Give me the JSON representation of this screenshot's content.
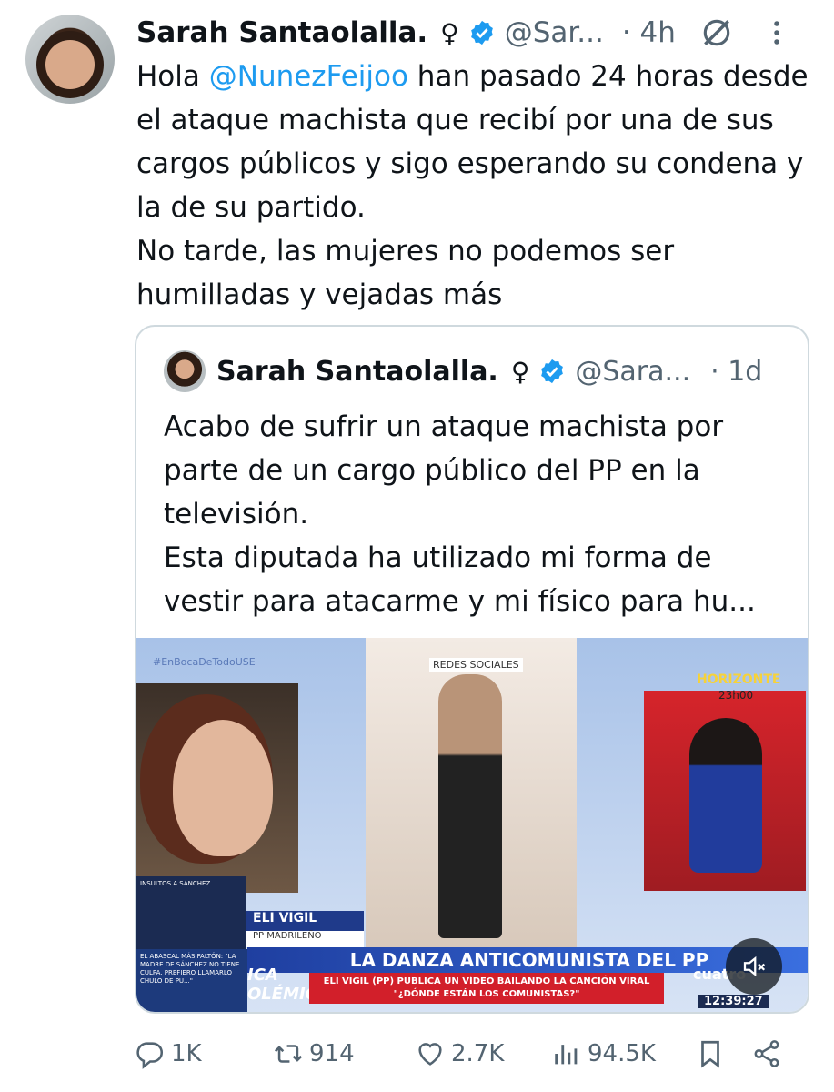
{
  "tweet": {
    "author_name": "Sarah Santaolalla.",
    "gender_symbol": "♀",
    "handle": "@Sar...",
    "time": "· 4h",
    "text_prefix": "Hola ",
    "mention": "@NunezFeijoo",
    "text_rest": " han pasado 24 horas desde el ataque machista que recibí por una de sus cargos públicos y sigo esperando su condena y la de su partido.",
    "text_line2": "No tarde, las mujeres no podemos ser humilladas y vejadas más"
  },
  "quote": {
    "author_name": "Sarah Santaolalla.",
    "gender_symbol": "♀",
    "handle": "@Sara...",
    "time": "· 1d",
    "text_line1": "Acabo de sufrir un ataque machista por parte de un cargo público del PP en la televisión.",
    "text_line2": "Esta diputada ha utilizado mi forma de vestir para atacarme y mi físico para hu..."
  },
  "media": {
    "tag_top": "#EnBocaDeTodoUSE",
    "tag_redes": "REDES SOCIALES",
    "tag_horizonte": "HORIZONTE",
    "tag_time": "23h00",
    "mini_header": "INSULTOS A SÁNCHEZ",
    "lower_name": "ELI VIGIL",
    "lower_party": "PP MADRILEÑO",
    "mini_caption": "EL ABASCAL MÁS FALTÓN: \"LA MADRE DE SÁNCHEZ NO TIENE CULPA. PREFIERO LLAMARLO CHULO DE PU...\"",
    "side_label": "ICA OLÉMIC",
    "headline": "LA DANZA ANTICOMUNISTA DEL PP",
    "subheadline": "ELI VIGIL (PP) PUBLICA UN VÍDEO BAILANDO LA CANCIÓN VIRAL \"¿DÓNDE ESTÁN LOS COMUNISTAS?\"",
    "channel": "cuatro",
    "clock": "12:39:27"
  },
  "actions": {
    "replies": "1K",
    "retweets": "914",
    "likes": "2.7K",
    "views": "94.5K"
  },
  "colors": {
    "link": "#1d9bf0",
    "muted": "#536471",
    "border": "#cfd9de",
    "verified": "#1d9bf0"
  }
}
